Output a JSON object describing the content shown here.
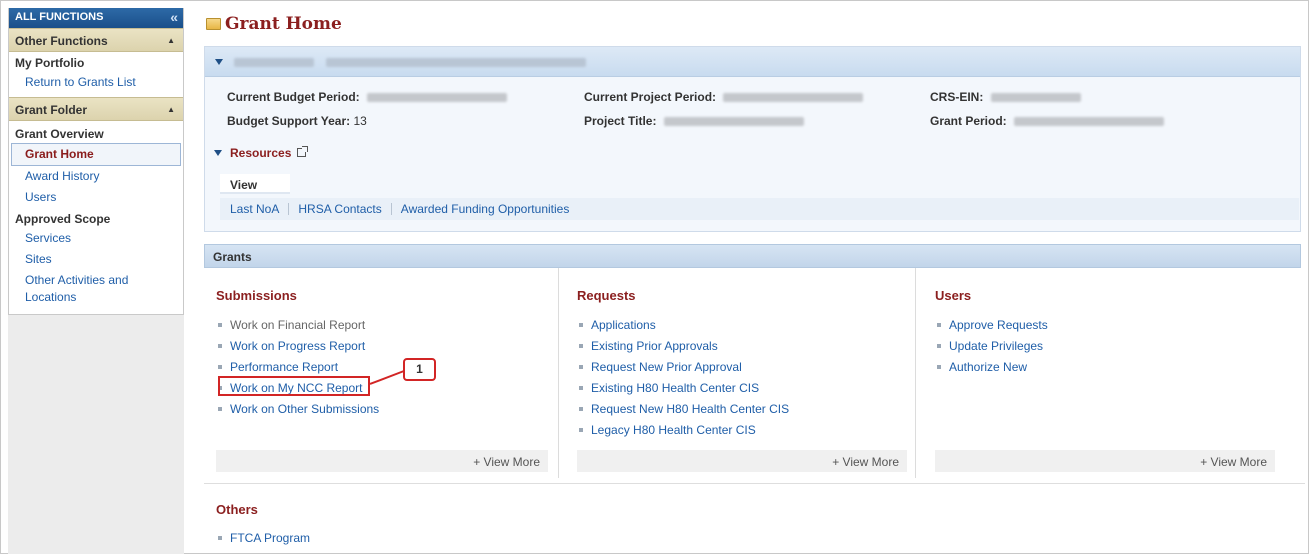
{
  "sidebar": {
    "top_label": "ALL FUNCTIONS",
    "collapse_glyph": "«",
    "other_functions": "Other Functions",
    "my_portfolio": "My Portfolio",
    "return_link": "Return to Grants List",
    "grant_folder": "Grant Folder",
    "grant_overview": "Grant Overview",
    "grant_home": "Grant Home",
    "award_history": "Award History",
    "users": "Users",
    "approved_scope": "Approved Scope",
    "services": "Services",
    "sites": "Sites",
    "other_activities": "Other Activities and",
    "locations": "Locations"
  },
  "page": {
    "title": "Grant Home"
  },
  "grant_info": {
    "current_budget_period_label": "Current Budget Period:",
    "current_project_period_label": "Current Project Period:",
    "crs_ein_label": "CRS-EIN:",
    "budget_support_year_label": "Budget Support Year:",
    "budget_support_year_value": "13",
    "project_title_label": "Project Title:",
    "grant_period_label": "Grant Period:"
  },
  "resources": {
    "label": "Resources",
    "view_tab": "View",
    "links": [
      "Last NoA",
      "HRSA Contacts",
      "Awarded Funding Opportunities"
    ]
  },
  "grants": {
    "header": "Grants",
    "submissions": {
      "title": "Submissions",
      "items": [
        "Work on Financial Report",
        "Work on Progress Report",
        "Performance Report",
        "Work on My NCC Report",
        "Work on Other Submissions"
      ],
      "view_more": "+ View More"
    },
    "requests": {
      "title": "Requests",
      "items": [
        "Applications",
        "Existing Prior Approvals",
        "Request New Prior Approval",
        "Existing H80 Health Center CIS",
        "Request New H80 Health Center CIS",
        "Legacy H80 Health Center CIS"
      ],
      "view_more": "+ View More"
    },
    "users": {
      "title": "Users",
      "items": [
        "Approve Requests",
        "Update Privileges",
        "Authorize New"
      ],
      "view_more": "+ View More"
    }
  },
  "callout": {
    "number": "1"
  },
  "others": {
    "title": "Others",
    "items": [
      "FTCA Program"
    ]
  }
}
